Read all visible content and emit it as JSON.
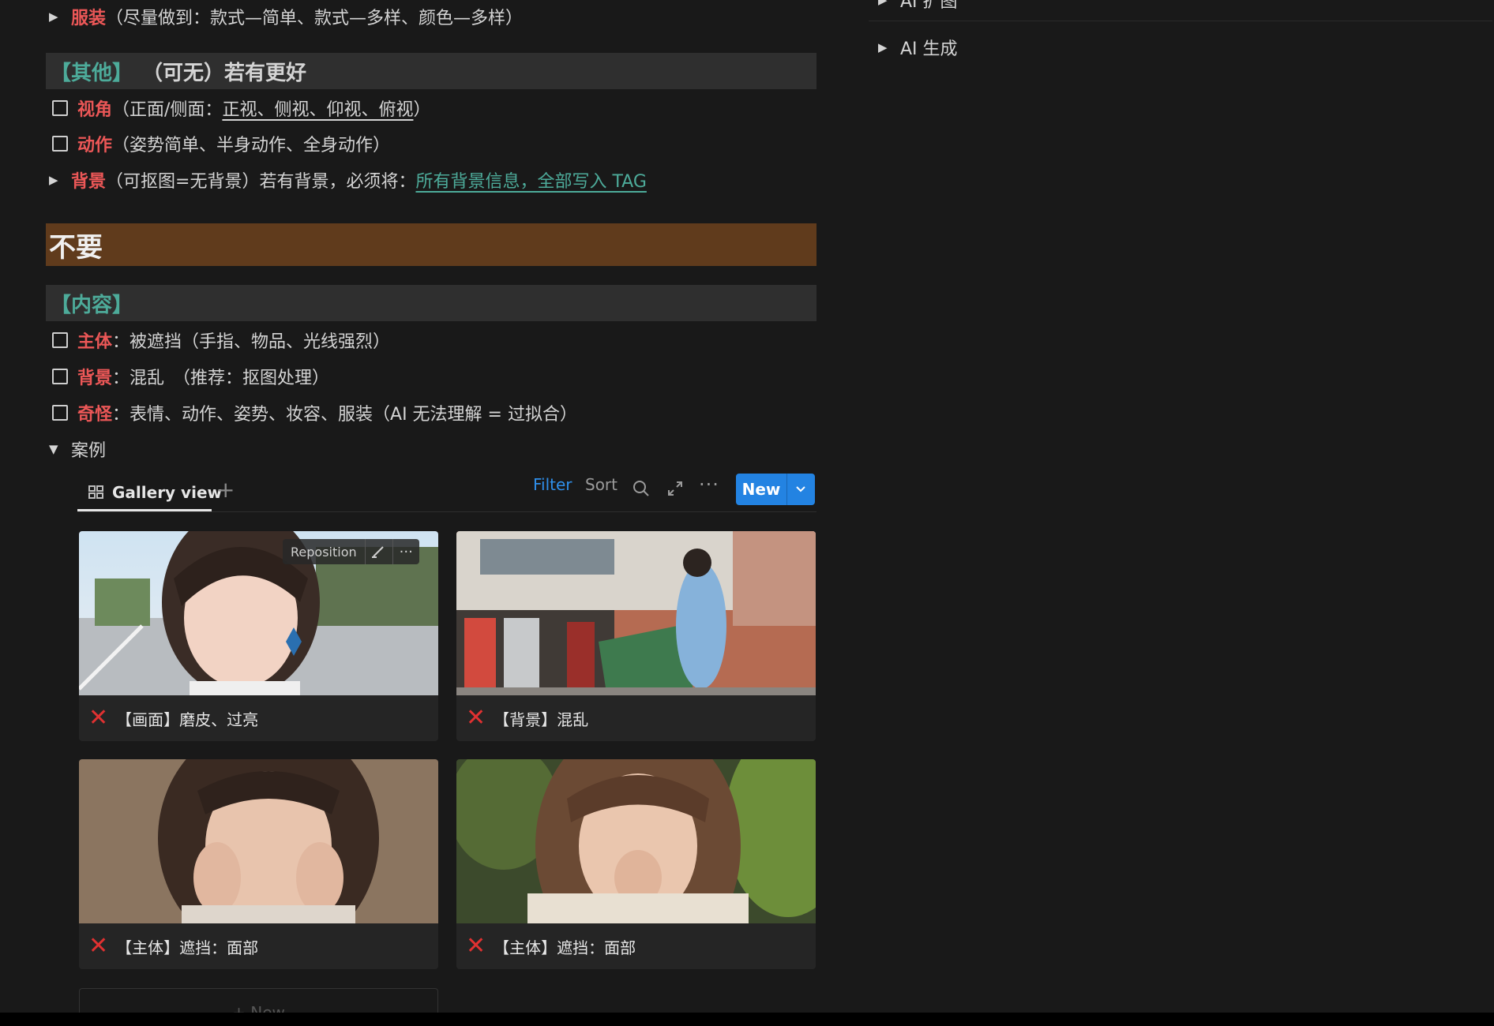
{
  "top_rows": [
    {
      "tri": "▶",
      "label": "服装",
      "rest": "（尽量做到：款式—简单、款式—多样、颜色—多样）"
    }
  ],
  "others_heading": {
    "bracket": "【其他】",
    "text": "（可无）若有更好"
  },
  "others_items": [
    {
      "label": "视角",
      "pre": "（正面/侧面：",
      "link": "正视、侧视、仰视、俯视",
      "post": "）"
    },
    {
      "label": "动作",
      "rest": "（姿势简单、半身动作、全身动作）"
    },
    {
      "label": "背景",
      "rest": "（可抠图=无背景）若有背景，必须将：",
      "link": "所有背景信息，全部写入 TAG"
    }
  ],
  "dont_heading": "不要",
  "content_heading": "【内容】",
  "content_items": [
    {
      "label": "主体",
      "rest": "：被遮挡（手指、物品、光线强烈）"
    },
    {
      "label": "背景",
      "rest": "：混乱　（推荐：抠图处理）"
    },
    {
      "label": "奇怪",
      "rest": "：表情、动作、姿势、妆容、服装（AI 无法理解 = 过拟合）"
    }
  ],
  "cases_toggle": "案例",
  "gallery": {
    "tab_label": "Gallery view",
    "filter": "Filter",
    "sort": "Sort",
    "new_label": "New",
    "reposition": "Reposition",
    "new_row": "+ New",
    "cards": [
      {
        "caption": "【画面】磨皮、过亮"
      },
      {
        "caption": "【背景】混乱"
      },
      {
        "caption": "【主体】遮挡：面部"
      },
      {
        "caption": "【主体】遮挡：面部"
      }
    ]
  },
  "right_panel": {
    "toggle_partial": "AI  扩图",
    "toggle_label": "AI  生成"
  },
  "colors": {
    "background": "#191919",
    "red": "#eb5757",
    "green": "#4dab9a",
    "brown": "#603b1c",
    "accent": "#2383e2"
  }
}
